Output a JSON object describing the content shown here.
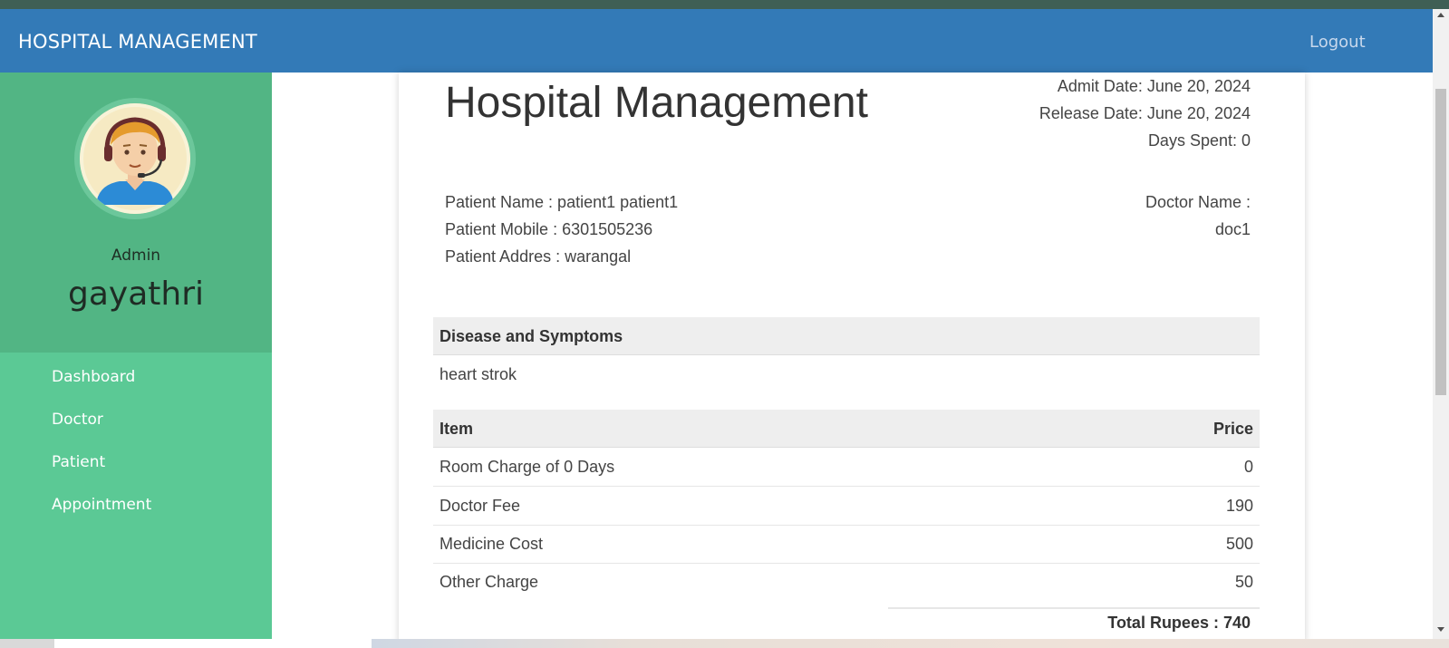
{
  "navbar": {
    "brand": "HOSPITAL MANAGEMENT",
    "logout": "Logout",
    "color": "#337ab7"
  },
  "sidebar": {
    "role": "Admin",
    "username": "gayathri",
    "avatar_icon": "support-agent-avatar-icon",
    "items": [
      {
        "label": "Dashboard"
      },
      {
        "label": "Doctor"
      },
      {
        "label": "Patient"
      },
      {
        "label": "Appointment"
      }
    ],
    "colors": {
      "profile": "#52b584",
      "menu": "#5bc995"
    }
  },
  "bill": {
    "title": "Hospital Management",
    "admit_date": "Admit Date: June 20, 2024",
    "release_date": "Release Date: June 20, 2024",
    "days_spent": "Days Spent: 0",
    "patient_name": "Patient Name : patient1 patient1",
    "patient_mobile": "Patient Mobile : 6301505236",
    "patient_address": "Patient Addres : warangal",
    "doctor_label": "Doctor Name :",
    "doctor_name": "doc1",
    "disease_header": "Disease and Symptoms",
    "disease": "heart strok",
    "item_header": "Item",
    "price_header": "Price",
    "rows": [
      {
        "item": "Room Charge of 0 Days",
        "price": "0"
      },
      {
        "item": "Doctor Fee",
        "price": "190"
      },
      {
        "item": "Medicine Cost",
        "price": "500"
      },
      {
        "item": "Other Charge",
        "price": "50"
      }
    ],
    "total": "Total Rupees : 740"
  }
}
